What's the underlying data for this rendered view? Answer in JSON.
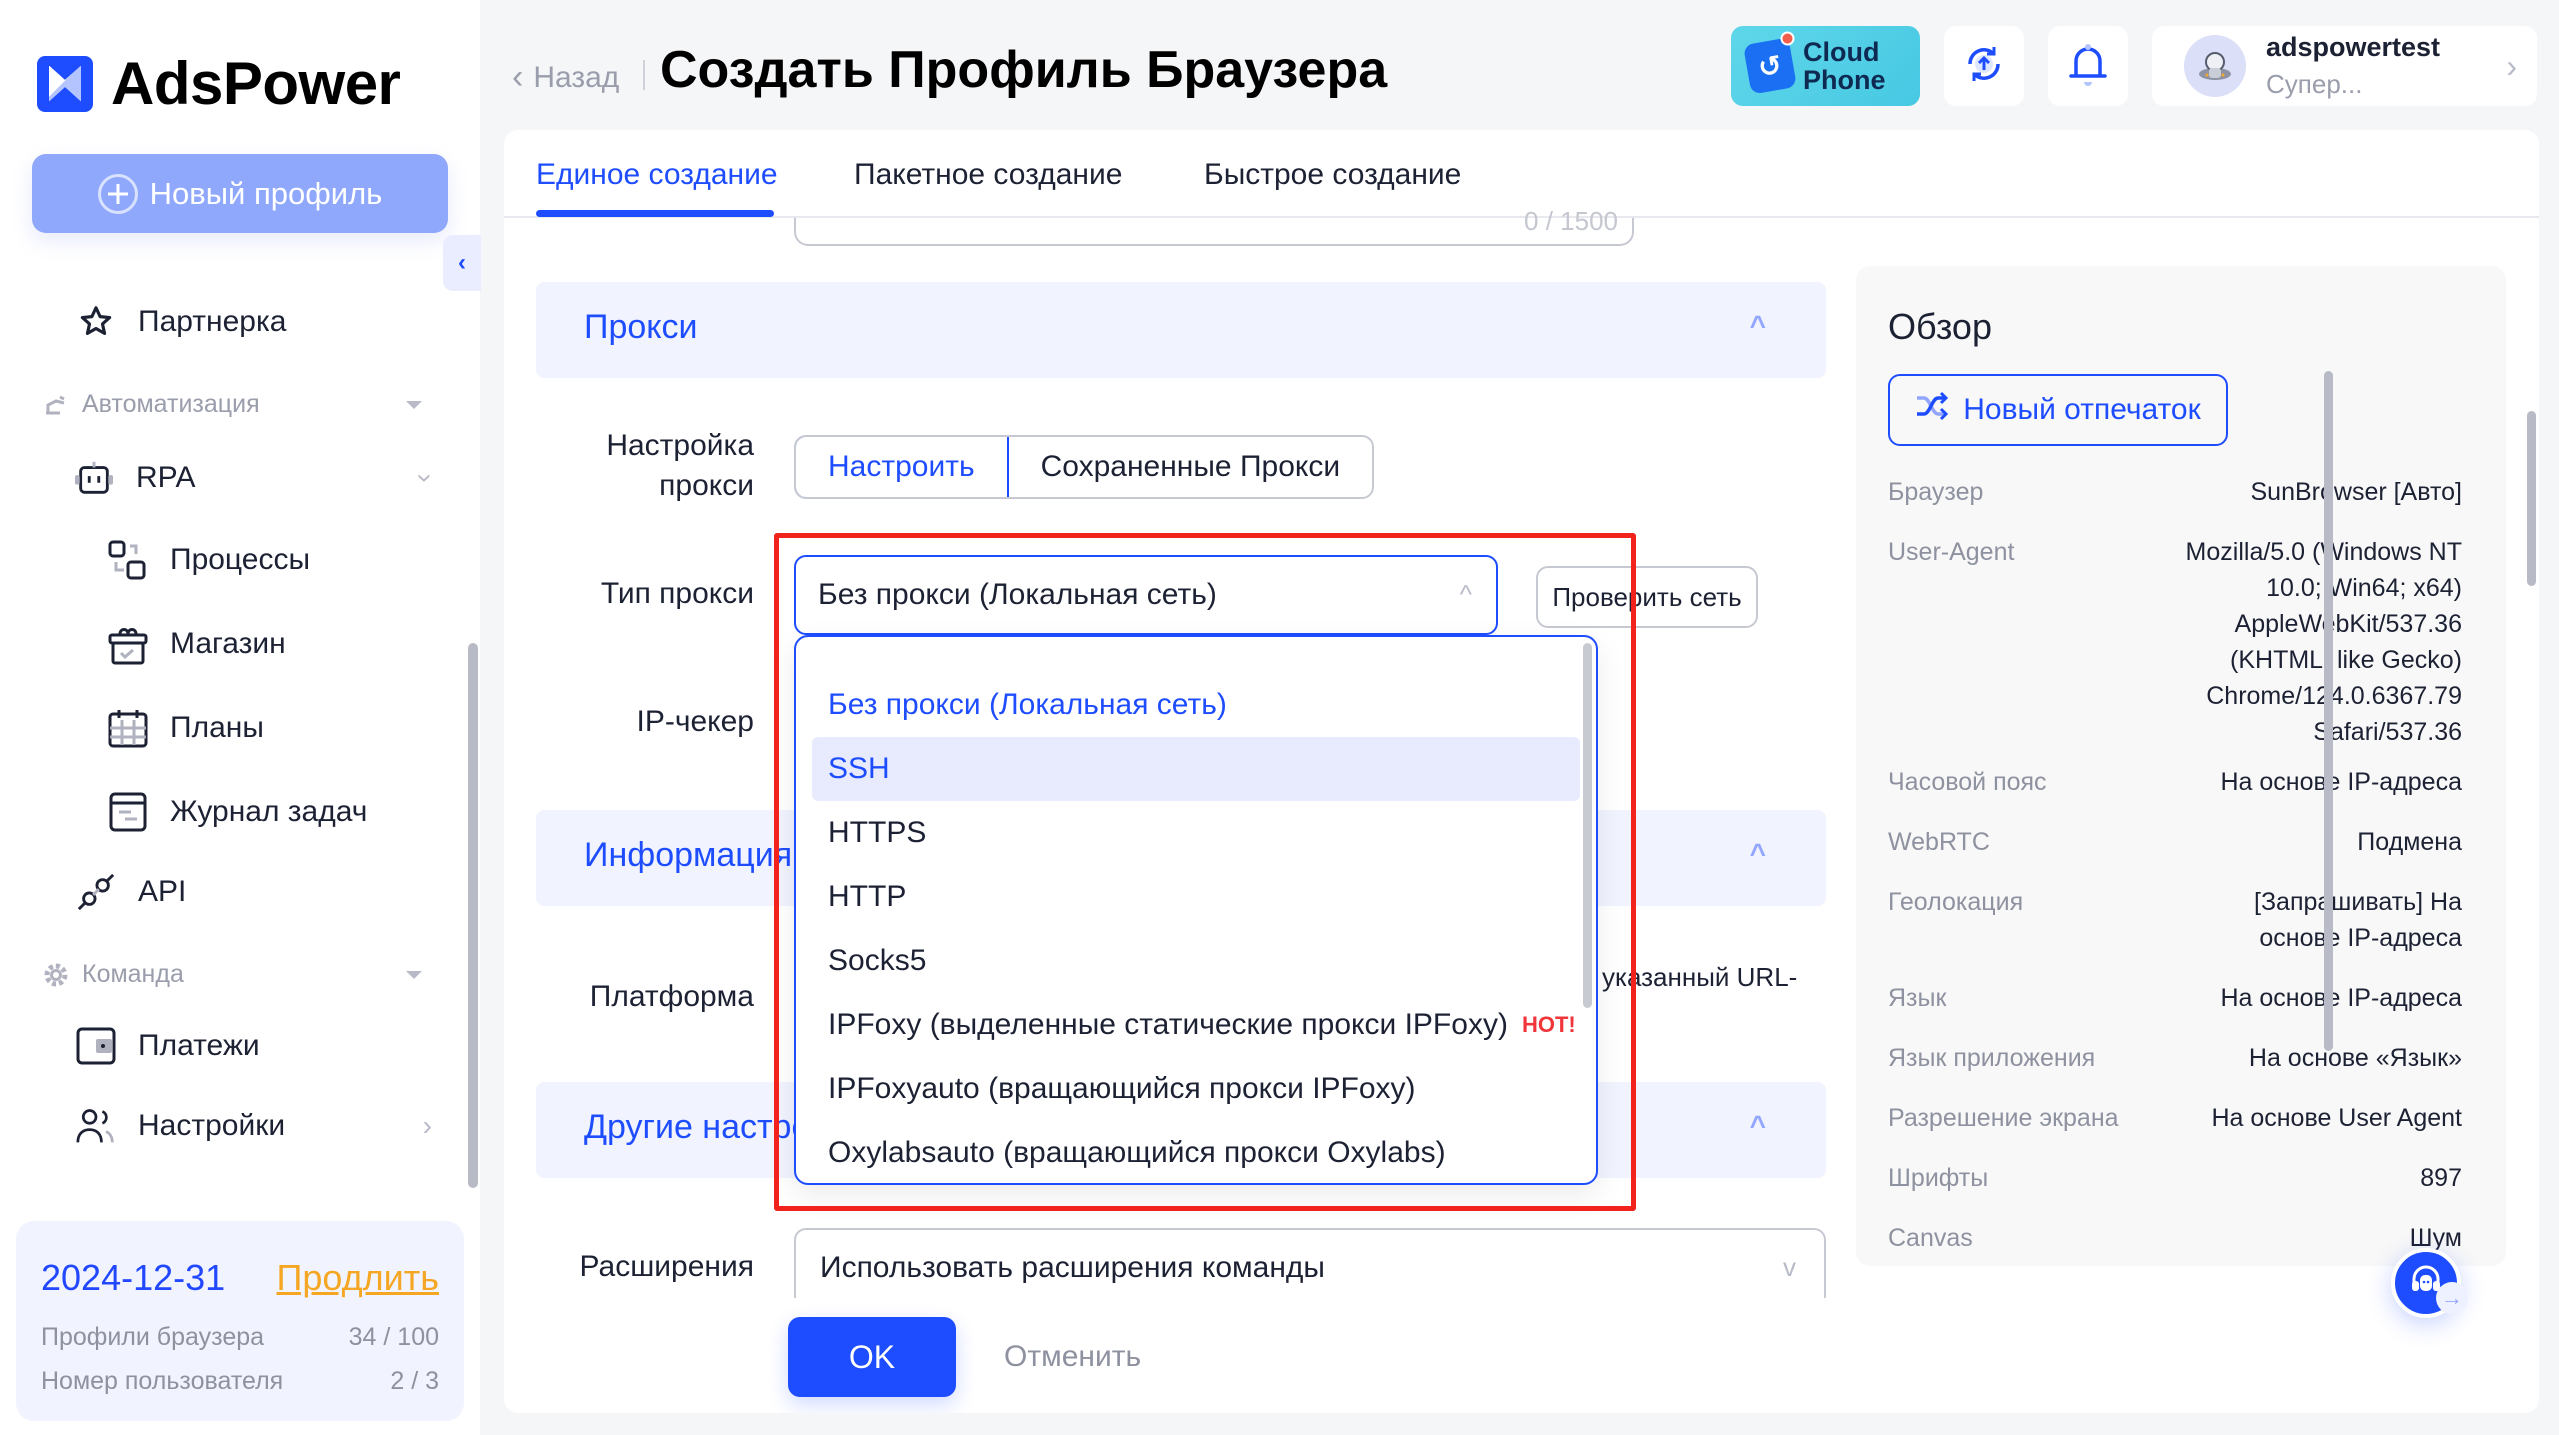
{
  "app": {
    "brand": "AdsPower",
    "new_profile_label": "Новый профиль"
  },
  "sidebar": {
    "items": [
      {
        "label": "Партнерка",
        "icon": "star-icon"
      },
      {
        "label": "Автоматизация",
        "icon": "automation-icon",
        "group": true
      },
      {
        "label": "RPA",
        "icon": "robot-icon"
      },
      {
        "label": "Процессы",
        "icon": "process-icon"
      },
      {
        "label": "Магазин",
        "icon": "store-icon"
      },
      {
        "label": "Планы",
        "icon": "calendar-icon"
      },
      {
        "label": "Журнал задач",
        "icon": "task-log-icon"
      },
      {
        "label": "API",
        "icon": "plug-icon"
      },
      {
        "label": "Команда",
        "icon": "gear-icon",
        "group": true
      },
      {
        "label": "Платежи",
        "icon": "wallet-icon"
      },
      {
        "label": "Настройки",
        "icon": "users-icon"
      }
    ],
    "plan": {
      "expiry": "2024-12-31",
      "renew_label": "Продлить",
      "rows": [
        {
          "label": "Профили браузера",
          "value": "34 / 100"
        },
        {
          "label": "Номер пользователя",
          "value": "2 / 3"
        }
      ]
    }
  },
  "header": {
    "back_label": "Назад",
    "title": "Создать Профиль Браузера",
    "cloud_phone": {
      "line1": "Cloud",
      "line2": "Phone"
    },
    "user": {
      "name": "adspowertest",
      "role": "Супер..."
    }
  },
  "tabs": [
    {
      "label": "Единое создание",
      "active": true
    },
    {
      "label": "Пакетное создание",
      "active": false
    },
    {
      "label": "Быстрое создание",
      "active": false
    }
  ],
  "form": {
    "textarea_counter": "0 / 1500",
    "proxy_section": "Прокси",
    "proxy_setting_label_1": "Настройка",
    "proxy_setting_label_2": "прокси",
    "proxy_mode_options": [
      "Настроить",
      "Сохраненные Прокси"
    ],
    "proxy_type_label": "Тип прокси",
    "proxy_type_value": "Без прокси (Локальная сеть)",
    "check_network_label": "Проверить сеть",
    "ip_checker_label": "IP-чекер",
    "info_section": "Информация",
    "platform_label": "Платформа",
    "platform_hint_partial": "указанный URL-",
    "other_section": "Другие настройки",
    "extensions_label": "Расширения",
    "extensions_value": "Использовать расширения команды",
    "ok_label": "OK",
    "cancel_label": "Отменить"
  },
  "proxy_dropdown": {
    "options": [
      {
        "label": "Без прокси (Локальная сеть)",
        "state": "selected"
      },
      {
        "label": "SSH",
        "state": "hover"
      },
      {
        "label": "HTTPS",
        "state": ""
      },
      {
        "label": "HTTP",
        "state": ""
      },
      {
        "label": "Socks5",
        "state": ""
      },
      {
        "label": "IPFoxy (выделенные статические прокси IPFoxy)",
        "state": "",
        "badge": "HOT!"
      },
      {
        "label": "IPFoxyauto (вращающийся прокси IPFoxy)",
        "state": ""
      },
      {
        "label": "Oxylabsauto (вращающийся прокси Oxylabs)",
        "state": ""
      }
    ]
  },
  "overview": {
    "title": "Обзор",
    "new_fingerprint_label": "Новый отпечаток",
    "rows": [
      {
        "key": "Браузер",
        "value": "SunBrowser [Авто]"
      },
      {
        "key": "User-Agent",
        "value": "Mozilla/5.0 (Windows NT 10.0; Win64; x64) AppleWebKit/537.36 (KHTML, like Gecko) Chrome/124.0.6367.79 Safari/537.36"
      },
      {
        "key": "Часовой пояс",
        "value": "На основе IP-адреса"
      },
      {
        "key": "WebRTC",
        "value": "Подмена"
      },
      {
        "key": "Геолокация",
        "value": "[Запрашивать] На основе IP-адреса"
      },
      {
        "key": "Язык",
        "value": "На основе IP-адреса"
      },
      {
        "key": "Язык приложения",
        "value": "На основе «Язык»"
      },
      {
        "key": "Разрешение экрана",
        "value": "На основе User Agent"
      },
      {
        "key": "Шрифты",
        "value": "897"
      },
      {
        "key": "Canvas",
        "value": "Шум"
      }
    ]
  },
  "colors": {
    "accent": "#1e4dff",
    "renew": "#f5a623",
    "hot": "#f0353b",
    "highlight": "#f2231c"
  }
}
